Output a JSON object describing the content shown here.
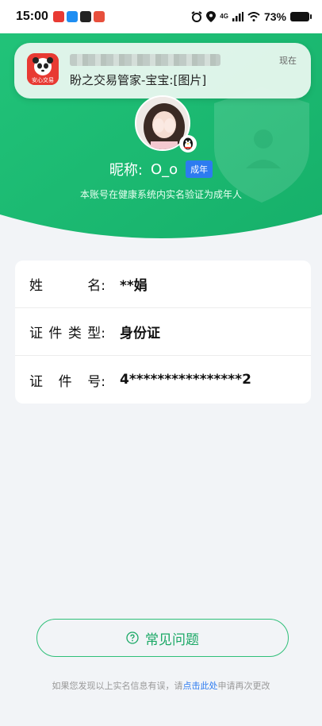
{
  "status_bar": {
    "time": "15:00",
    "network": "4G",
    "battery": "73%"
  },
  "notification": {
    "app_name": "安心交易",
    "body": "盼之交易管家-宝宝:[图片]",
    "time": "现在"
  },
  "profile": {
    "nickname_label": "昵称:",
    "nickname": "O_o",
    "badge": "成年",
    "verify_text": "本账号在健康系统内实名验证为成年人"
  },
  "info_rows": [
    {
      "label_chars": [
        "姓",
        "名:"
      ],
      "value": "**娟"
    },
    {
      "label_chars": [
        "证",
        "件",
        "类",
        "型:"
      ],
      "value": "身份证"
    },
    {
      "label_chars": [
        "证",
        "件",
        "号:"
      ],
      "value": "4****************2"
    }
  ],
  "faq": {
    "label": "常见问题"
  },
  "footer": {
    "prefix": "如果您发现以上实名信息有误，请",
    "link": "点击此处",
    "suffix": "申请再次更改"
  },
  "colors": {
    "green": "#1fbe74",
    "blue_badge": "#2d7bf0"
  }
}
